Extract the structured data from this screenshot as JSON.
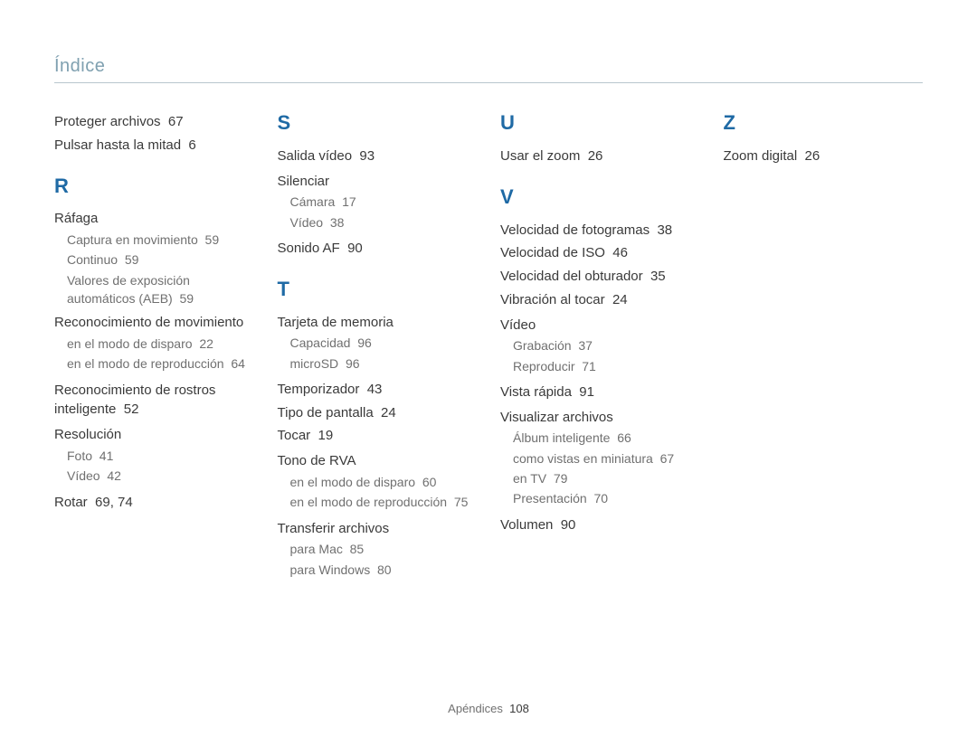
{
  "header": {
    "title": "Índice"
  },
  "footer": {
    "section": "Apéndices",
    "page": "108"
  },
  "col1": {
    "pre": [
      {
        "t": "Proteger archivos",
        "p": "67"
      },
      {
        "t": "Pulsar hasta la mitad",
        "p": "6"
      }
    ],
    "letter_r": "R",
    "r_groups": [
      {
        "head": "Ráfaga",
        "subs": [
          {
            "t": "Captura en movimiento",
            "p": "59"
          },
          {
            "t": "Continuo",
            "p": "59"
          },
          {
            "t": "Valores de exposición automáticos (AEB)",
            "p": "59"
          }
        ]
      },
      {
        "head": "Reconocimiento de movimiento",
        "subs": [
          {
            "t": "en el modo de disparo",
            "p": "22"
          },
          {
            "t": "en el modo de reproducción",
            "p": "64"
          }
        ]
      }
    ],
    "r_entries_mid": [
      {
        "t": "Reconocimiento de rostros inteligente",
        "p": "52"
      }
    ],
    "r_group_res": {
      "head": "Resolución",
      "subs": [
        {
          "t": "Foto",
          "p": "41"
        },
        {
          "t": "Vídeo",
          "p": "42"
        }
      ]
    },
    "r_final": {
      "t": "Rotar",
      "p": "69, 74"
    }
  },
  "col2": {
    "letter_s": "S",
    "s_entries_pre": [
      {
        "t": "Salida vídeo",
        "p": "93"
      }
    ],
    "s_group_sil": {
      "head": "Silenciar",
      "subs": [
        {
          "t": "Cámara",
          "p": "17"
        },
        {
          "t": "Vídeo",
          "p": "38"
        }
      ]
    },
    "s_entries_post": [
      {
        "t": "Sonido AF",
        "p": "90"
      }
    ],
    "letter_t": "T",
    "t_group_tarj": {
      "head": "Tarjeta de memoria",
      "subs": [
        {
          "t": "Capacidad",
          "p": "96"
        },
        {
          "t": "microSD",
          "p": "96"
        }
      ]
    },
    "t_entries_mid": [
      {
        "t": "Temporizador",
        "p": "43"
      },
      {
        "t": "Tipo de pantalla",
        "p": "24"
      },
      {
        "t": "Tocar",
        "p": "19"
      }
    ],
    "t_group_tono": {
      "head": "Tono de RVA",
      "subs": [
        {
          "t": "en el modo de disparo",
          "p": "60"
        },
        {
          "t": "en el modo de reproducción",
          "p": "75"
        }
      ]
    },
    "t_group_transf": {
      "head": "Transferir archivos",
      "subs": [
        {
          "t": "para Mac",
          "p": "85"
        },
        {
          "t": "para Windows",
          "p": "80"
        }
      ]
    }
  },
  "col3": {
    "letter_u": "U",
    "u_entries": [
      {
        "t": "Usar el zoom",
        "p": "26"
      }
    ],
    "letter_v": "V",
    "v_entries_pre": [
      {
        "t": "Velocidad de fotogramas",
        "p": "38"
      },
      {
        "t": "Velocidad de ISO",
        "p": "46"
      },
      {
        "t": "Velocidad del obturador",
        "p": "35"
      },
      {
        "t": "Vibración al tocar",
        "p": "24"
      }
    ],
    "v_group_video": {
      "head": "Vídeo",
      "subs": [
        {
          "t": "Grabación",
          "p": "37"
        },
        {
          "t": "Reproducir",
          "p": "71"
        }
      ]
    },
    "v_entries_mid": [
      {
        "t": "Vista rápida",
        "p": "91"
      }
    ],
    "v_group_vis": {
      "head": "Visualizar archivos",
      "subs": [
        {
          "t": "Álbum inteligente",
          "p": "66"
        },
        {
          "t": "como vistas en miniatura",
          "p": "67"
        },
        {
          "t": "en TV",
          "p": "79"
        },
        {
          "t": "Presentación",
          "p": "70"
        }
      ]
    },
    "v_entries_post": [
      {
        "t": "Volumen",
        "p": "90"
      }
    ]
  },
  "col4": {
    "letter_z": "Z",
    "z_entries": [
      {
        "t": "Zoom digital",
        "p": "26"
      }
    ]
  }
}
